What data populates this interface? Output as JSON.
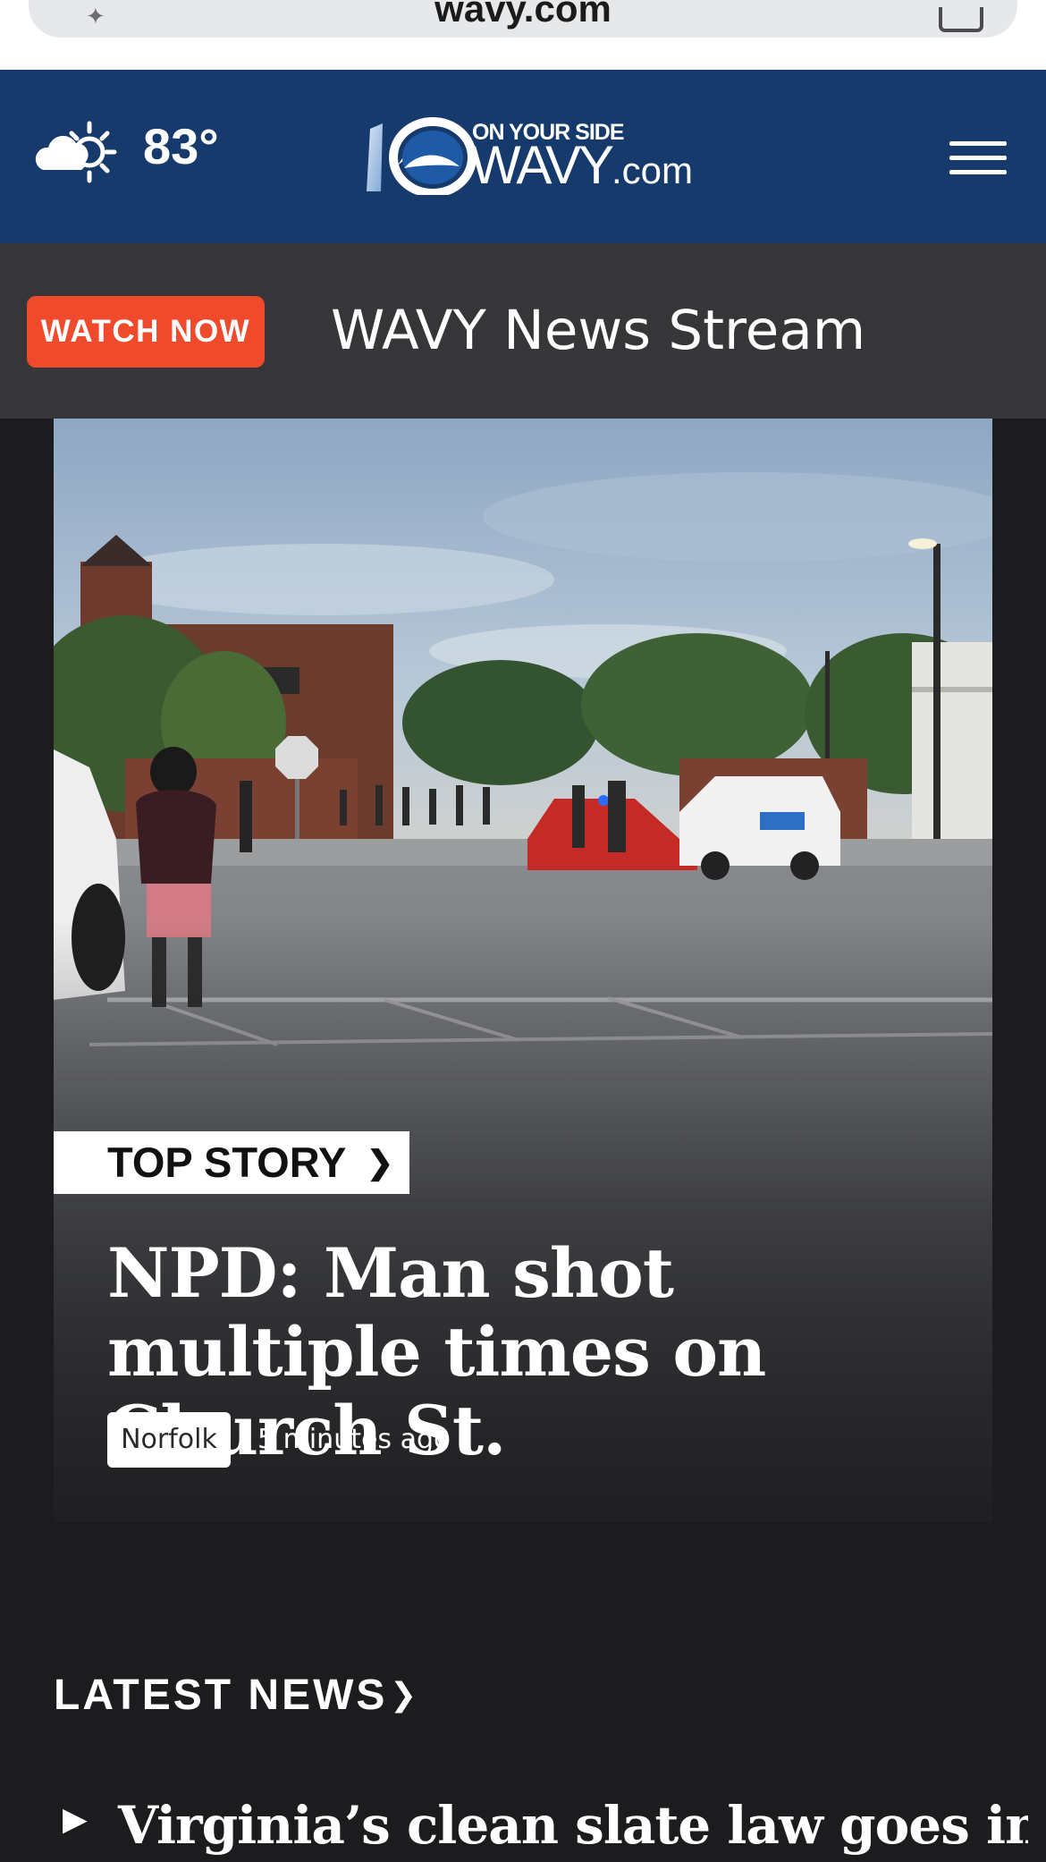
{
  "browser": {
    "url": "wavy.com",
    "tabs_icon": "tabs-icon",
    "left_icon": "sparkle-icon"
  },
  "header": {
    "weather_icon": "partly-cloudy-icon",
    "temperature": "83°",
    "logo": {
      "tagline": "ON YOUR SIDE",
      "name": "WAVY",
      "suffix": ".com",
      "mark": "10"
    },
    "menu_icon": "hamburger-menu-icon",
    "background_color": "#163a6b"
  },
  "watch_bar": {
    "badge_label": "WATCH NOW",
    "title": "WAVY News Stream",
    "badge_color": "#ef4a2b"
  },
  "hero": {
    "kicker": "TOP STORY",
    "headline": "NPD: Man shot multiple times on Church St.",
    "location": "Norfolk",
    "time": "5 minutes ago"
  },
  "latest_news": {
    "heading": "LATEST NEWS",
    "items": [
      {
        "title": "Virginia’s clean slate law goes into"
      }
    ]
  }
}
